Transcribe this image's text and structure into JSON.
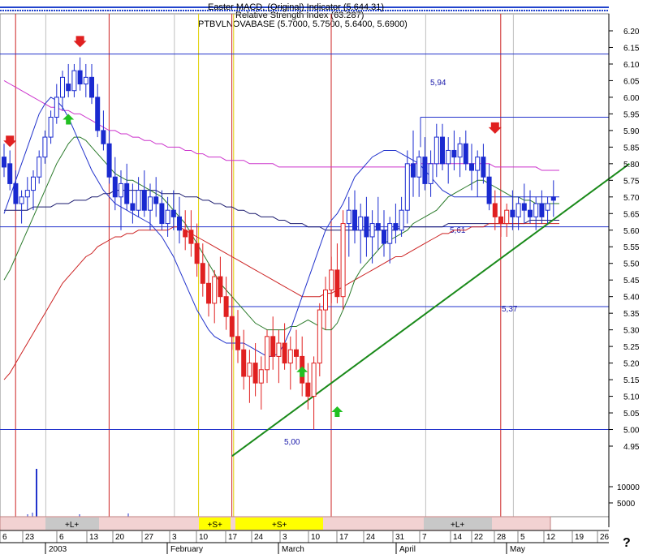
{
  "header": {
    "line1": "Easter MACD, (Original) Indicator (5.644.31)",
    "line2": "Relative Strength Index (63.287)",
    "line3": "PTBVLNOVABASE (5.7000, 5.7500, 5.6400, 5.6900)"
  },
  "help_mark": "?",
  "chart_data": {
    "type": "candlestick",
    "symbol": "PTBVLNOVABASE",
    "last_ohlc": {
      "open": 5.7,
      "high": 5.75,
      "low": 5.64,
      "close": 5.69
    },
    "ylim": [
      4.95,
      6.2
    ],
    "y_ticks": [
      "6.20",
      "6.15",
      "6.10",
      "6.05",
      "6.00",
      "5.95",
      "5.90",
      "5.85",
      "5.80",
      "5.75",
      "5.70",
      "5.65",
      "5.60",
      "5.55",
      "5.50",
      "5.45",
      "5.40",
      "5.35",
      "5.30",
      "5.25",
      "5.20",
      "5.15",
      "5.10",
      "5.05",
      "5.00",
      "4.95"
    ],
    "volume_ticks": [
      "10000",
      "5000"
    ],
    "x_day_labels": [
      "6",
      "23",
      "6",
      "13",
      "20",
      "27",
      "3",
      "10",
      "17",
      "24",
      "3",
      "10",
      "17",
      "24",
      "31",
      "7",
      "14",
      "22",
      "28",
      "5",
      "12",
      "19",
      "26"
    ],
    "x_month_labels": [
      {
        "label": "2003",
        "day_index": 3
      },
      {
        "label": "February",
        "day_index": 28
      },
      {
        "label": "March",
        "day_index": 48
      },
      {
        "label": "April",
        "day_index": 70
      },
      {
        "label": "May",
        "day_index": 89
      }
    ],
    "horizontal_levels": [
      {
        "value": 6.13,
        "label": ""
      },
      {
        "value": 5.94,
        "label": "5,94"
      },
      {
        "value": 5.61,
        "label": "5,61"
      },
      {
        "value": 5.37,
        "label": "5,37"
      },
      {
        "value": 5.0,
        "label": "5,00"
      }
    ],
    "trendline": {
      "from": {
        "day_index": 39,
        "value": 4.92
      },
      "to": {
        "day_index": 107,
        "value": 5.8
      }
    },
    "signal_bands": [
      {
        "label": "+L+",
        "from_index": 7,
        "to_index": 17
      },
      {
        "label": "+S+",
        "from_index": 34,
        "to_index": 39
      },
      {
        "label": "+S+",
        "from_index": 40,
        "to_index": 56
      },
      {
        "label": "+L+",
        "from_index": 74,
        "to_index": 86
      }
    ],
    "down_arrows": [
      {
        "day_index": 1,
        "value": 5.86
      },
      {
        "day_index": 13,
        "value": 6.16
      },
      {
        "day_index": 84,
        "value": 5.9
      }
    ],
    "up_arrows": [
      {
        "day_index": 11,
        "value": 5.94
      },
      {
        "day_index": 51,
        "value": 5.18
      },
      {
        "day_index": 57,
        "value": 5.06
      }
    ],
    "moving_averages": [
      {
        "color": "#cc33cc",
        "values": [
          6.05,
          6.04,
          6.03,
          6.02,
          6.01,
          6.0,
          5.99,
          5.98,
          5.97,
          5.97,
          5.96,
          5.96,
          5.95,
          5.95,
          5.94,
          5.93,
          5.92,
          5.91,
          5.9,
          5.9,
          5.89,
          5.89,
          5.88,
          5.88,
          5.87,
          5.87,
          5.86,
          5.86,
          5.85,
          5.85,
          5.85,
          5.84,
          5.84,
          5.83,
          5.83,
          5.82,
          5.82,
          5.82,
          5.81,
          5.81,
          5.81,
          5.81,
          5.8,
          5.8,
          5.8,
          5.8,
          5.8,
          5.79,
          5.79,
          5.79,
          5.79,
          5.79,
          5.79,
          5.79,
          5.79,
          5.79,
          5.79,
          5.79,
          5.79,
          5.79,
          5.79,
          5.79,
          5.79,
          5.79,
          5.79,
          5.79,
          5.79,
          5.79,
          5.79,
          5.79,
          5.8,
          5.8,
          5.8,
          5.8,
          5.8,
          5.8,
          5.8,
          5.8,
          5.8,
          5.8,
          5.8,
          5.8,
          5.8,
          5.8,
          5.79,
          5.79,
          5.79,
          5.79,
          5.79,
          5.79,
          5.79,
          5.79,
          5.78,
          5.78,
          5.78,
          5.78
        ]
      },
      {
        "color": "#1a1a6e",
        "values": [
          5.66,
          5.66,
          5.66,
          5.66,
          5.66,
          5.67,
          5.67,
          5.67,
          5.67,
          5.68,
          5.68,
          5.68,
          5.69,
          5.69,
          5.69,
          5.7,
          5.7,
          5.71,
          5.71,
          5.72,
          5.72,
          5.72,
          5.72,
          5.72,
          5.72,
          5.72,
          5.72,
          5.71,
          5.71,
          5.71,
          5.71,
          5.7,
          5.7,
          5.7,
          5.69,
          5.69,
          5.68,
          5.68,
          5.67,
          5.67,
          5.66,
          5.66,
          5.65,
          5.65,
          5.64,
          5.64,
          5.64,
          5.63,
          5.63,
          5.62,
          5.62,
          5.62,
          5.61,
          5.61,
          5.61,
          5.6,
          5.6,
          5.6,
          5.6,
          5.6,
          5.6,
          5.6,
          5.6,
          5.6,
          5.6,
          5.6,
          5.6,
          5.6,
          5.61,
          5.61,
          5.61,
          5.61,
          5.61,
          5.61,
          5.61,
          5.61,
          5.62,
          5.62,
          5.62,
          5.62,
          5.62,
          5.62,
          5.62,
          5.62,
          5.62,
          5.62,
          5.62,
          5.62,
          5.62,
          5.62,
          5.63,
          5.63,
          5.63,
          5.63,
          5.63,
          5.63
        ]
      },
      {
        "color": "#cc2222",
        "values": [
          5.15,
          5.17,
          5.2,
          5.23,
          5.26,
          5.29,
          5.32,
          5.35,
          5.38,
          5.41,
          5.44,
          5.46,
          5.48,
          5.5,
          5.52,
          5.53,
          5.55,
          5.56,
          5.57,
          5.58,
          5.58,
          5.59,
          5.59,
          5.6,
          5.6,
          5.6,
          5.6,
          5.6,
          5.6,
          5.61,
          5.61,
          5.6,
          5.59,
          5.58,
          5.57,
          5.56,
          5.55,
          5.54,
          5.53,
          5.52,
          5.51,
          5.5,
          5.49,
          5.48,
          5.47,
          5.46,
          5.45,
          5.44,
          5.43,
          5.42,
          5.41,
          5.4,
          5.4,
          5.4,
          5.4,
          5.41,
          5.41,
          5.42,
          5.43,
          5.44,
          5.45,
          5.46,
          5.47,
          5.48,
          5.49,
          5.5,
          5.51,
          5.52,
          5.52,
          5.53,
          5.54,
          5.55,
          5.56,
          5.57,
          5.58,
          5.59,
          5.59,
          5.6,
          5.6,
          5.6,
          5.61,
          5.61,
          5.61,
          5.62,
          5.62,
          5.62,
          5.62,
          5.62,
          5.62,
          5.62,
          5.62,
          5.62,
          5.62,
          5.62,
          5.62,
          5.62
        ]
      },
      {
        "color": "#2a7a2a",
        "values": [
          5.45,
          5.48,
          5.52,
          5.56,
          5.6,
          5.64,
          5.68,
          5.72,
          5.76,
          5.8,
          5.83,
          5.86,
          5.88,
          5.88,
          5.87,
          5.85,
          5.83,
          5.81,
          5.79,
          5.77,
          5.76,
          5.75,
          5.75,
          5.74,
          5.73,
          5.72,
          5.71,
          5.7,
          5.68,
          5.66,
          5.64,
          5.62,
          5.59,
          5.56,
          5.53,
          5.5,
          5.47,
          5.44,
          5.42,
          5.4,
          5.38,
          5.36,
          5.34,
          5.32,
          5.31,
          5.3,
          5.3,
          5.3,
          5.3,
          5.31,
          5.31,
          5.32,
          5.33,
          5.32,
          5.31,
          5.3,
          5.3,
          5.32,
          5.36,
          5.4,
          5.45,
          5.48,
          5.5,
          5.52,
          5.54,
          5.56,
          5.57,
          5.58,
          5.59,
          5.6,
          5.62,
          5.63,
          5.64,
          5.65,
          5.66,
          5.68,
          5.7,
          5.71,
          5.72,
          5.73,
          5.74,
          5.75,
          5.75,
          5.74,
          5.73,
          5.72,
          5.71,
          5.7,
          5.7,
          5.69,
          5.69,
          5.68,
          5.68,
          5.68,
          5.68,
          5.68
        ]
      },
      {
        "color": "#2233cc",
        "values": [
          5.65,
          5.7,
          5.75,
          5.8,
          5.85,
          5.9,
          5.95,
          5.98,
          6.0,
          5.99,
          5.97,
          5.94,
          5.9,
          5.86,
          5.82,
          5.78,
          5.75,
          5.72,
          5.7,
          5.68,
          5.67,
          5.66,
          5.65,
          5.64,
          5.63,
          5.62,
          5.6,
          5.58,
          5.55,
          5.52,
          5.48,
          5.44,
          5.4,
          5.36,
          5.33,
          5.3,
          5.28,
          5.27,
          5.26,
          5.26,
          5.26,
          5.26,
          5.25,
          5.24,
          5.23,
          5.22,
          5.22,
          5.23,
          5.26,
          5.3,
          5.35,
          5.4,
          5.45,
          5.5,
          5.55,
          5.6,
          5.63,
          5.65,
          5.68,
          5.72,
          5.76,
          5.78,
          5.8,
          5.82,
          5.83,
          5.84,
          5.84,
          5.84,
          5.83,
          5.82,
          5.81,
          5.8,
          5.78,
          5.76,
          5.74,
          5.72,
          5.71,
          5.7,
          5.7,
          5.7,
          5.7,
          5.7,
          5.7,
          5.7,
          5.7,
          5.7,
          5.7,
          5.7,
          5.7,
          5.7,
          5.7,
          5.7,
          5.7,
          5.7,
          5.7,
          5.7
        ]
      }
    ],
    "candles": [
      [
        5.82,
        5.86,
        5.76,
        5.79
      ],
      [
        5.8,
        5.84,
        5.72,
        5.74
      ],
      [
        5.74,
        5.78,
        5.66,
        5.68
      ],
      [
        5.68,
        5.72,
        5.62,
        5.7
      ],
      [
        5.7,
        5.76,
        5.66,
        5.72
      ],
      [
        5.72,
        5.78,
        5.66,
        5.76
      ],
      [
        5.76,
        5.84,
        5.74,
        5.82
      ],
      [
        5.82,
        5.9,
        5.8,
        5.88
      ],
      [
        5.88,
        5.96,
        5.86,
        5.94
      ],
      [
        5.94,
        6.04,
        5.92,
        6.0
      ],
      [
        6.0,
        6.08,
        5.96,
        6.06
      ],
      [
        6.04,
        6.1,
        6.0,
        6.02
      ],
      [
        6.02,
        6.1,
        6.0,
        6.08
      ],
      [
        6.08,
        6.12,
        6.02,
        6.04
      ],
      [
        6.04,
        6.1,
        6.0,
        6.06
      ],
      [
        6.06,
        6.1,
        5.98,
        6.0
      ],
      [
        6.0,
        6.04,
        5.88,
        5.9
      ],
      [
        5.9,
        5.96,
        5.84,
        5.86
      ],
      [
        5.86,
        5.9,
        5.74,
        5.76
      ],
      [
        5.76,
        5.82,
        5.66,
        5.7
      ],
      [
        5.7,
        5.78,
        5.6,
        5.74
      ],
      [
        5.74,
        5.8,
        5.66,
        5.68
      ],
      [
        5.68,
        5.74,
        5.62,
        5.66
      ],
      [
        5.66,
        5.76,
        5.64,
        5.72
      ],
      [
        5.72,
        5.78,
        5.64,
        5.66
      ],
      [
        5.66,
        5.74,
        5.6,
        5.7
      ],
      [
        5.7,
        5.76,
        5.64,
        5.68
      ],
      [
        5.68,
        5.72,
        5.6,
        5.62
      ],
      [
        5.62,
        5.7,
        5.58,
        5.66
      ],
      [
        5.66,
        5.72,
        5.6,
        5.64
      ],
      [
        5.64,
        5.7,
        5.56,
        5.6
      ],
      [
        5.6,
        5.66,
        5.54,
        5.58
      ],
      [
        5.6,
        5.66,
        5.52,
        5.56
      ],
      [
        5.56,
        5.62,
        5.46,
        5.5
      ],
      [
        5.5,
        5.56,
        5.4,
        5.44
      ],
      [
        5.44,
        5.5,
        5.34,
        5.38
      ],
      [
        5.38,
        5.48,
        5.32,
        5.46
      ],
      [
        5.46,
        5.52,
        5.38,
        5.4
      ],
      [
        5.4,
        5.46,
        5.3,
        5.34
      ],
      [
        5.34,
        5.4,
        5.24,
        5.28
      ],
      [
        5.28,
        5.36,
        5.2,
        5.24
      ],
      [
        5.24,
        5.3,
        5.12,
        5.16
      ],
      [
        5.16,
        5.24,
        5.08,
        5.2
      ],
      [
        5.2,
        5.26,
        5.1,
        5.14
      ],
      [
        5.14,
        5.22,
        5.06,
        5.18
      ],
      [
        5.18,
        5.3,
        5.14,
        5.28
      ],
      [
        5.28,
        5.34,
        5.18,
        5.22
      ],
      [
        5.22,
        5.3,
        5.14,
        5.26
      ],
      [
        5.26,
        5.32,
        5.18,
        5.2
      ],
      [
        5.2,
        5.28,
        5.12,
        5.24
      ],
      [
        5.24,
        5.3,
        5.18,
        5.22
      ],
      [
        5.22,
        5.28,
        5.1,
        5.14
      ],
      [
        5.14,
        5.2,
        5.06,
        5.1
      ],
      [
        5.1,
        5.22,
        5.0,
        5.2
      ],
      [
        5.2,
        5.38,
        5.16,
        5.36
      ],
      [
        5.36,
        5.46,
        5.3,
        5.42
      ],
      [
        5.42,
        5.52,
        5.38,
        5.48
      ],
      [
        5.48,
        5.56,
        5.38,
        5.4
      ],
      [
        5.4,
        5.66,
        5.36,
        5.62
      ],
      [
        5.62,
        5.7,
        5.52,
        5.66
      ],
      [
        5.66,
        5.72,
        5.56,
        5.6
      ],
      [
        5.6,
        5.68,
        5.5,
        5.64
      ],
      [
        5.64,
        5.7,
        5.52,
        5.58
      ],
      [
        5.58,
        5.66,
        5.5,
        5.62
      ],
      [
        5.62,
        5.7,
        5.54,
        5.6
      ],
      [
        5.6,
        5.66,
        5.52,
        5.56
      ],
      [
        5.56,
        5.64,
        5.5,
        5.62
      ],
      [
        5.62,
        5.68,
        5.56,
        5.6
      ],
      [
        5.6,
        5.7,
        5.58,
        5.66
      ],
      [
        5.66,
        5.84,
        5.62,
        5.8
      ],
      [
        5.8,
        5.9,
        5.7,
        5.76
      ],
      [
        5.76,
        5.84,
        5.7,
        5.82
      ],
      [
        5.82,
        5.88,
        5.72,
        5.74
      ],
      [
        5.74,
        5.84,
        5.7,
        5.8
      ],
      [
        5.8,
        5.92,
        5.76,
        5.88
      ],
      [
        5.88,
        5.92,
        5.78,
        5.8
      ],
      [
        5.8,
        5.88,
        5.74,
        5.84
      ],
      [
        5.84,
        5.9,
        5.78,
        5.82
      ],
      [
        5.82,
        5.88,
        5.76,
        5.86
      ],
      [
        5.86,
        5.9,
        5.78,
        5.8
      ],
      [
        5.8,
        5.86,
        5.72,
        5.78
      ],
      [
        5.78,
        5.84,
        5.7,
        5.82
      ],
      [
        5.82,
        5.86,
        5.74,
        5.76
      ],
      [
        5.76,
        5.8,
        5.66,
        5.68
      ],
      [
        5.68,
        5.72,
        5.6,
        5.64
      ],
      [
        5.64,
        5.7,
        5.58,
        5.62
      ],
      [
        5.62,
        5.68,
        5.58,
        5.66
      ],
      [
        5.66,
        5.72,
        5.6,
        5.64
      ],
      [
        5.64,
        5.7,
        5.6,
        5.68
      ],
      [
        5.68,
        5.74,
        5.62,
        5.66
      ],
      [
        5.66,
        5.72,
        5.62,
        5.64
      ],
      [
        5.64,
        5.7,
        5.6,
        5.68
      ],
      [
        5.68,
        5.72,
        5.62,
        5.64
      ],
      [
        5.66,
        5.7,
        5.62,
        5.68
      ],
      [
        5.7,
        5.75,
        5.64,
        5.69
      ]
    ],
    "volume": [
      0,
      0,
      0,
      0,
      0,
      0,
      0,
      0,
      0,
      0,
      0,
      0,
      0,
      0,
      0,
      0,
      0,
      0,
      0,
      0,
      0,
      0,
      0,
      0,
      0,
      0,
      0,
      0,
      0,
      0,
      0,
      0,
      0,
      0,
      0,
      0,
      0,
      0,
      0,
      0,
      0,
      0,
      0,
      0,
      0,
      0,
      0,
      0,
      0,
      0,
      0,
      0,
      0,
      0,
      0,
      0,
      0,
      0,
      0,
      0,
      0,
      0,
      0,
      0,
      0,
      0,
      0,
      0,
      0,
      0,
      0,
      0,
      0,
      0,
      0,
      0,
      0,
      0,
      0,
      0,
      0,
      0,
      0,
      0,
      0,
      0,
      0,
      0,
      0,
      0,
      0,
      0,
      0,
      0,
      0,
      0
    ]
  }
}
